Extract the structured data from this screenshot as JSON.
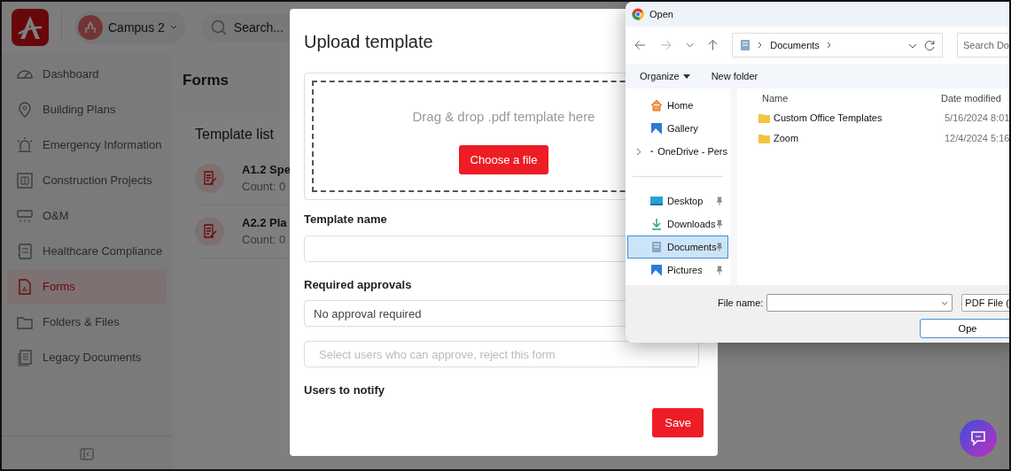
{
  "app": {
    "campus": "Campus 2",
    "search": {
      "placeholder": "Search..."
    }
  },
  "sidebar": {
    "items": [
      {
        "label": "Dashboard",
        "selected": false
      },
      {
        "label": "Building Plans",
        "selected": false
      },
      {
        "label": "Emergency Information",
        "selected": false
      },
      {
        "label": "Construction Projects",
        "selected": false
      },
      {
        "label": "O&M",
        "selected": false
      },
      {
        "label": "Healthcare Compliance",
        "selected": false
      },
      {
        "label": "Forms",
        "selected": true
      },
      {
        "label": "Folders & Files",
        "selected": false
      },
      {
        "label": "Legacy Documents",
        "selected": false
      }
    ]
  },
  "page": {
    "title": "Forms",
    "template_list": {
      "title": "Template list",
      "items": [
        {
          "name": "A1.2 Spe",
          "count": "Count: 0"
        },
        {
          "name": "A2.2 Pla",
          "count": "Count: 0"
        }
      ]
    }
  },
  "modal": {
    "title": "Upload template",
    "dropzone": {
      "text": "Drag & drop .pdf template here",
      "button": "Choose a file"
    },
    "template_name": {
      "label": "Template name"
    },
    "required_approvals": {
      "label": "Required approvals",
      "value": "No approval required",
      "approvers_placeholder": "Select users who can approve, reject this form"
    },
    "users_to_notify": {
      "label": "Users to notify"
    },
    "save_button": "Save"
  },
  "file_dialog": {
    "title": "Open",
    "address": "Documents",
    "search_placeholder": "Search Do",
    "toolbar": [
      "Organize",
      "New folder"
    ],
    "nav_groups": [
      [
        {
          "label": "Home",
          "selected": false,
          "expandable": false,
          "pinned": false
        },
        {
          "label": "Gallery",
          "selected": false,
          "expandable": false,
          "pinned": false
        },
        {
          "label": "OneDrive - Pers",
          "selected": false,
          "expandable": true,
          "pinned": false
        }
      ],
      [
        {
          "label": "Desktop",
          "selected": false,
          "expandable": false,
          "pinned": true
        },
        {
          "label": "Downloads",
          "selected": false,
          "expandable": false,
          "pinned": true
        },
        {
          "label": "Documents",
          "selected": true,
          "expandable": false,
          "pinned": true
        },
        {
          "label": "Pictures",
          "selected": false,
          "expandable": false,
          "pinned": true
        }
      ]
    ],
    "columns": [
      "Name",
      "Date modified"
    ],
    "rows": [
      {
        "name": "Custom Office Templates",
        "date": "5/16/2024 8:01"
      },
      {
        "name": "Zoom",
        "date": "12/4/2024 5:16"
      }
    ],
    "file_name_label": "File name:",
    "file_type": "PDF File (",
    "open_button": "Ope"
  }
}
